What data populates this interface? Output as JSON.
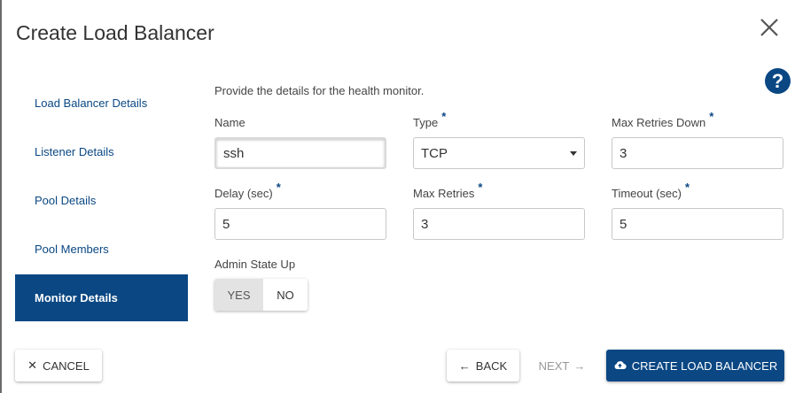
{
  "dialog": {
    "title": "Create Load Balancer",
    "close_icon": "close-icon",
    "help_label": "?"
  },
  "nav": {
    "items": [
      {
        "label": "Load Balancer Details",
        "active": false
      },
      {
        "label": "Listener Details",
        "active": false
      },
      {
        "label": "Pool Details",
        "active": false
      },
      {
        "label": "Pool Members",
        "active": false
      },
      {
        "label": "Monitor Details",
        "active": true
      }
    ]
  },
  "form": {
    "description": "Provide the details for the health monitor.",
    "name": {
      "label": "Name",
      "value": "ssh"
    },
    "type": {
      "label": "Type",
      "required": "*",
      "value": "TCP"
    },
    "max_retries_down": {
      "label": "Max Retries Down",
      "required": "*",
      "value": "3"
    },
    "delay": {
      "label": "Delay (sec)",
      "required": "*",
      "value": "5"
    },
    "max_retries": {
      "label": "Max Retries",
      "required": "*",
      "value": "3"
    },
    "timeout": {
      "label": "Timeout (sec)",
      "required": "*",
      "value": "5"
    },
    "admin_state": {
      "label": "Admin State Up",
      "yes": "YES",
      "no": "NO",
      "selected": "YES"
    }
  },
  "footer": {
    "cancel": {
      "icon": "✕",
      "label": "CANCEL"
    },
    "back": {
      "icon": "←",
      "label": "BACK"
    },
    "next": {
      "label": "NEXT",
      "icon": "→"
    },
    "create": {
      "icon": "cloud-upload-icon",
      "label": "CREATE LOAD BALANCER"
    }
  },
  "colors": {
    "accent": "#0a4783",
    "border": "#c8c8c8",
    "muted": "#999999"
  }
}
